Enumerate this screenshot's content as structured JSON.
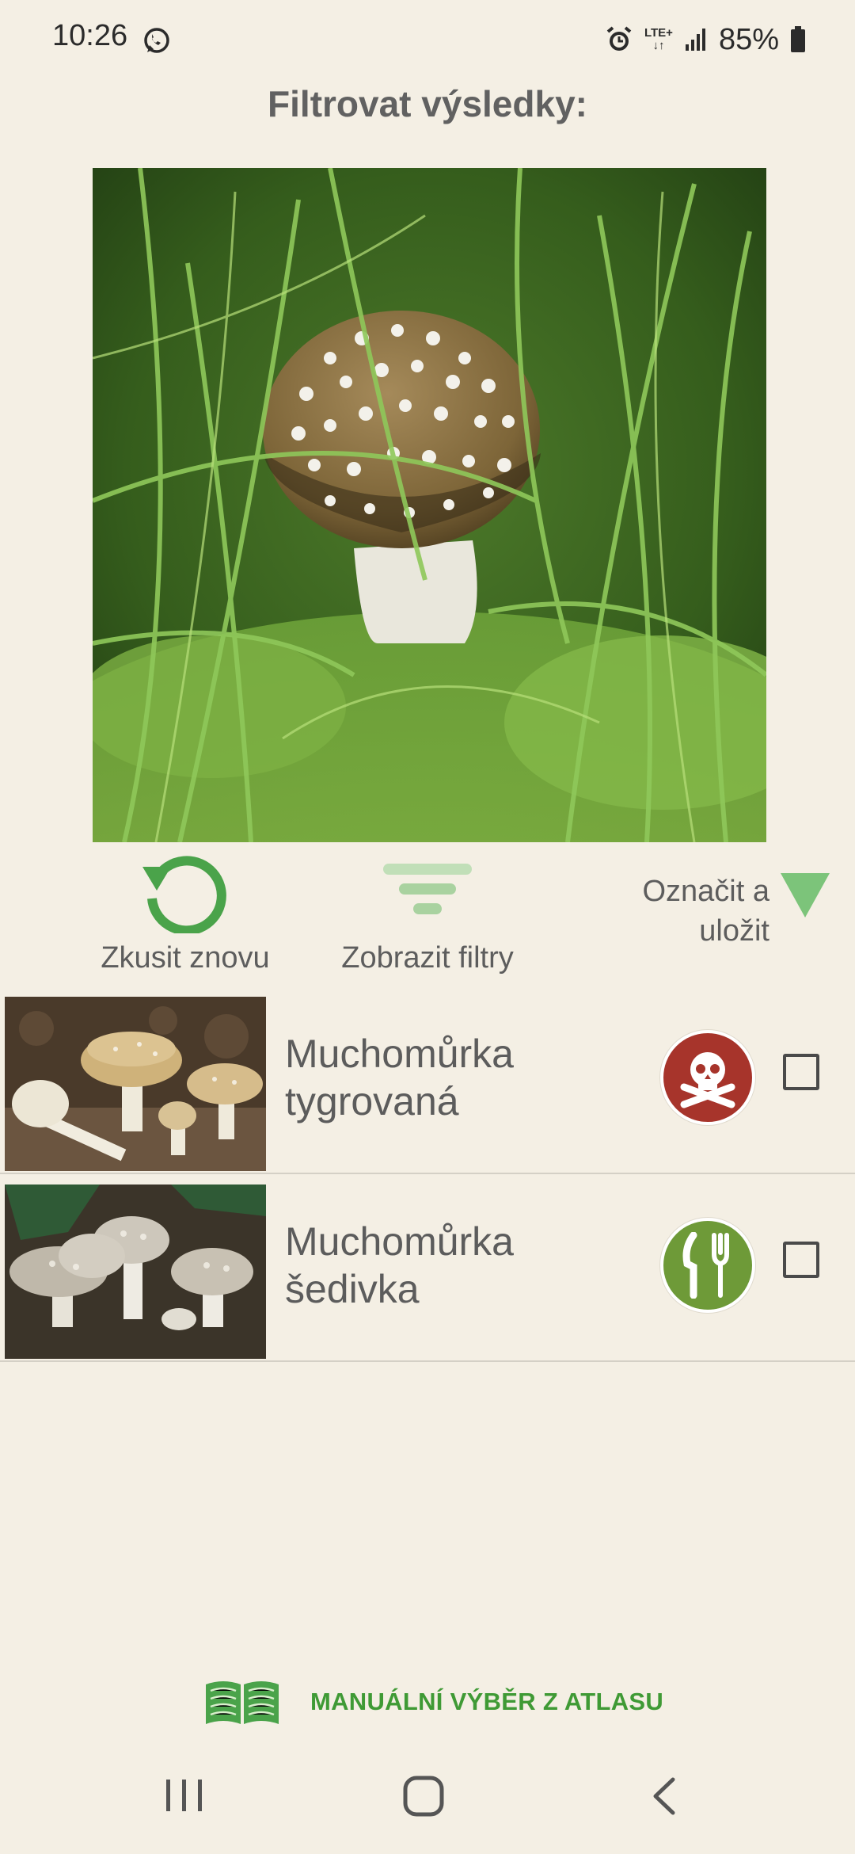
{
  "status_bar": {
    "time": "10:26",
    "network": "LTE+",
    "battery": "85%",
    "icons": [
      "whatsapp-icon",
      "alarm-icon",
      "lte-icon",
      "signal-icon",
      "battery-icon"
    ]
  },
  "header": {
    "title": "Filtrovat výsledky:"
  },
  "actions": {
    "retry_label": "Zkusit znovu",
    "filters_label": "Zobrazit filtry",
    "mark_save_label_1": "Označit a",
    "mark_save_label_2": "uložit"
  },
  "results": [
    {
      "name_1": "Muchomůrka",
      "name_2": "tygrovaná",
      "badge": "poison-icon",
      "badge_color": "#a7342b",
      "checked": false
    },
    {
      "name_1": "Muchomůrka",
      "name_2": "šedivka",
      "badge": "edible-icon",
      "badge_color": "#6e9a38",
      "checked": false
    }
  ],
  "manual": {
    "label": "MANUÁLNÍ VÝBĚR Z ATLASU"
  },
  "colors": {
    "background": "#f4efe4",
    "accent_green": "#3f9a35",
    "icon_green": "#54a950"
  }
}
